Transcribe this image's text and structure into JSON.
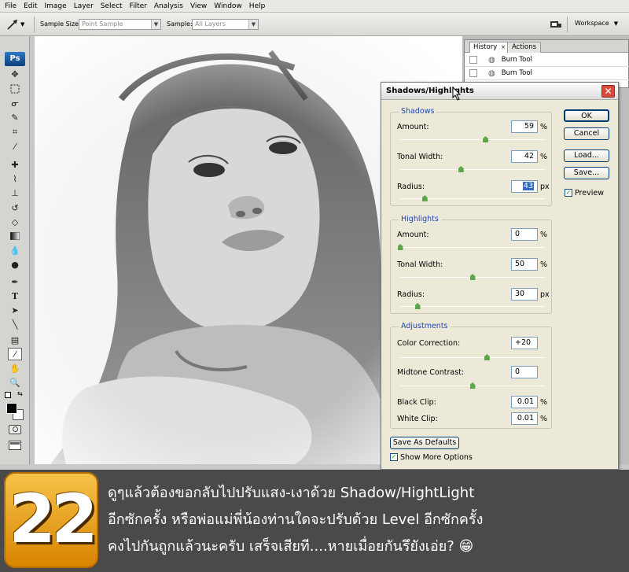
{
  "menu": [
    "File",
    "Edit",
    "Image",
    "Layer",
    "Select",
    "Filter",
    "Analysis",
    "View",
    "Window",
    "Help"
  ],
  "options": {
    "sample_size_label": "Sample Size:",
    "sample_size_value": "Point Sample",
    "sample_label": "Sample:",
    "sample_value": "All Layers",
    "workspace_label": "Workspace"
  },
  "toolbox": {
    "logo": "Ps",
    "tools": [
      "move-tool-icon",
      "marquee-tool-icon",
      "lasso-tool-icon",
      "quick-select-icon",
      "crop-tool-icon",
      "eyedropper-icon",
      "healing-brush-icon",
      "brush-tool-icon",
      "clone-stamp-icon",
      "history-brush-icon",
      "eraser-icon",
      "gradient-icon",
      "blur-icon",
      "dodge-icon",
      "pen-tool-icon",
      "type-tool-icon",
      "path-select-icon",
      "line-tool-icon",
      "notes-icon",
      "color-sampler-icon",
      "hand-tool-icon",
      "zoom-tool-icon"
    ]
  },
  "history_panel": {
    "tabs": [
      "History",
      "Actions"
    ],
    "items": [
      "Burn Tool",
      "Burn Tool"
    ]
  },
  "dialog": {
    "title": "Shadows/Highlights",
    "shadows": {
      "label": "Shadows",
      "amount_label": "Amount:",
      "amount": "59",
      "amount_unit": "%",
      "amount_level": 59,
      "tonal_label": "Tonal Width:",
      "tonal": "42",
      "tonal_unit": "%",
      "tonal_level": 42,
      "radius_label": "Radius:",
      "radius": "43",
      "radius_unit": "px",
      "radius_level": 17
    },
    "highlights": {
      "label": "Highlights",
      "amount_label": "Amount:",
      "amount": "0",
      "amount_unit": "%",
      "amount_level": 0,
      "tonal_label": "Tonal Width:",
      "tonal": "50",
      "tonal_unit": "%",
      "tonal_level": 50,
      "radius_label": "Radius:",
      "radius": "30",
      "radius_unit": "px",
      "radius_level": 12
    },
    "adjustments": {
      "label": "Adjustments",
      "color_label": "Color Correction:",
      "color": "+20",
      "color_level": 60,
      "midtone_label": "Midtone Contrast:",
      "midtone": "0",
      "midtone_level": 50,
      "black_label": "Black Clip:",
      "black": "0.01",
      "black_unit": "%",
      "white_label": "White Clip:",
      "white": "0.01",
      "white_unit": "%"
    },
    "buttons": {
      "ok": "OK",
      "cancel": "Cancel",
      "load": "Load...",
      "save": "Save..."
    },
    "preview_label": "Preview",
    "save_defaults": "Save As Defaults",
    "show_more": "Show More Options"
  },
  "banner": {
    "step_number": "22",
    "line1": "ดูๆแล้วต้องขอกลับไปปรับแสง-เงาด้วย Shadow/HightLight",
    "line2": "อีกซักครั้ง หรือพ่อแม่พี่น้องท่านใดจะปรับด้วย Level อีกซักครั้ง",
    "line3": "คงไปกันถูกแล้วนะครับ เสร็จเสียที....หายเมื่อยกันรึยังเอ่ย? 😁"
  },
  "colors": {
    "dialog_bg": "#ece9d8",
    "group_label": "#2046b0",
    "slider_thumb": "#5ea64a",
    "badge": "#f0a020",
    "banner_bg": "#4a4a4a"
  }
}
